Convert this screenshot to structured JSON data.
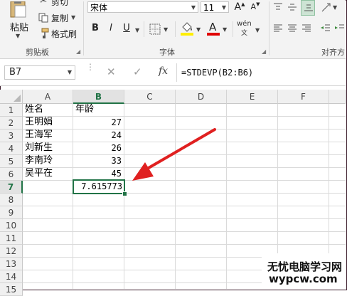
{
  "clipboard": {
    "paste_label": "粘贴",
    "copy_label": "复制",
    "format_painter_label": "格式刷",
    "cut_partial_label": "剪切",
    "group_label": "剪贴板"
  },
  "font": {
    "name": "宋体",
    "size": "11",
    "group_label": "字体",
    "grow_glyph": "A",
    "shrink_glyph": "A",
    "bold": "B",
    "italic": "I",
    "underline": "U",
    "phonetic_top": "wén",
    "phonetic_bottom": "文",
    "font_color_glyph": "A",
    "font_color": "#e00000",
    "fill_color": "#ffee00"
  },
  "alignment": {
    "group_label": "对齐方"
  },
  "formula_bar": {
    "name_box": "B7",
    "fx": "fx",
    "formula": "=STDEVP(B2:B6)"
  },
  "sheet": {
    "columns": [
      "A",
      "B",
      "C",
      "D",
      "E",
      "F"
    ],
    "selected_column": "B",
    "rows": [
      "1",
      "2",
      "3",
      "4",
      "5",
      "6",
      "7",
      "8",
      "9",
      "10",
      "11",
      "12",
      "13",
      "14",
      "15"
    ],
    "selected_row": "7",
    "cells": {
      "A1": "姓名",
      "B1": "年龄",
      "A2": "王明娟",
      "B2": "27",
      "A3": "王海军",
      "B3": "24",
      "A4": "刘新生",
      "B4": "26",
      "A5": "李南玲",
      "B5": "33",
      "A6": "吴平在",
      "B6": "45",
      "B7": "7.615773"
    },
    "accent_color": "#217346"
  },
  "annotation": {
    "arrow_color": "#e02020"
  },
  "watermark": {
    "title": "无忧电脑学习网",
    "url": "wypcw.com"
  }
}
